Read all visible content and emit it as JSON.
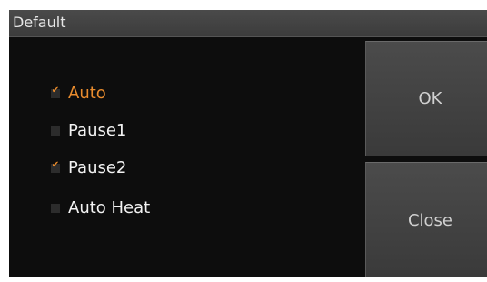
{
  "dialog": {
    "title": "Default"
  },
  "options": [
    {
      "label": "Auto",
      "checked": true,
      "active": true
    },
    {
      "label": "Pause1",
      "checked": false,
      "active": false
    },
    {
      "label": "Pause2",
      "checked": true,
      "active": false
    },
    {
      "label": "Auto Heat",
      "checked": false,
      "active": false
    }
  ],
  "buttons": {
    "ok_label": "OK",
    "close_label": "Close"
  },
  "colors": {
    "accent": "#e98c2e",
    "background": "#0d0d0d",
    "button": "#444444",
    "text": "#f2f2f2"
  },
  "icons": {
    "checked": "check-icon"
  }
}
